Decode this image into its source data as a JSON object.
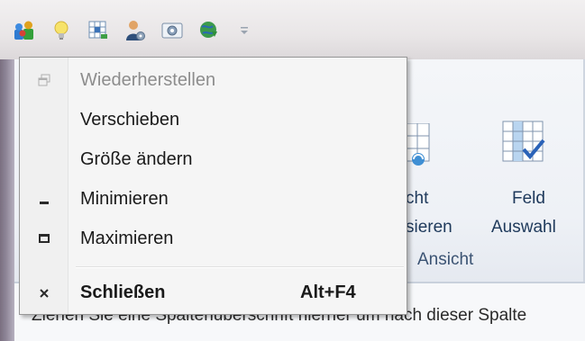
{
  "quick_access_toolbar": {
    "icons": [
      "users-icon",
      "lightbulb-icon",
      "grid-export-icon",
      "user-settings-icon",
      "camera-icon",
      "globe-download-icon"
    ],
    "customize_icon": "chevron-down-icon"
  },
  "ribbon": {
    "partial_button": {
      "line1": "cht",
      "line2": "sieren"
    },
    "field_select_button": {
      "line1": "Feld",
      "line2": "Auswahl"
    },
    "group_label": "Ansicht"
  },
  "content": {
    "group_hint": "Ziehen Sie eine Spaltenüberschrift hierher um nach dieser Spalte"
  },
  "system_menu": {
    "items": [
      {
        "label": "Wiederherstellen",
        "icon": "restore-icon",
        "disabled": true,
        "shortcut": ""
      },
      {
        "label": "Verschieben",
        "icon": "",
        "disabled": false,
        "shortcut": ""
      },
      {
        "label": "Größe ändern",
        "icon": "",
        "disabled": false,
        "shortcut": ""
      },
      {
        "label": "Minimieren",
        "icon": "minimize-icon",
        "disabled": false,
        "shortcut": ""
      },
      {
        "label": "Maximieren",
        "icon": "maximize-icon",
        "disabled": false,
        "shortcut": ""
      },
      {
        "label": "Schließen",
        "icon": "close-icon",
        "disabled": false,
        "shortcut": "Alt+F4"
      }
    ]
  },
  "colors": {
    "ribbon_text": "#1e395b",
    "menu_background": "#f5f5f5",
    "disabled_text": "#8d8d8d"
  }
}
